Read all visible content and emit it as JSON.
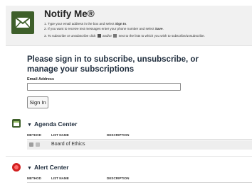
{
  "header": {
    "title": "Notify Me®",
    "line1": {
      "a": "1. Type your email address in the box and select ",
      "b": "Sign In",
      "c": "."
    },
    "line2": {
      "a": "2. If you want to receive text messages enter your phone number and select ",
      "b": "Save",
      "c": "."
    },
    "line3": {
      "a": "3. To subscribe or unsubscribe click ",
      "mid": " and/or ",
      "c": " next to the lists to which you wish to subscribe/unsubscribe."
    }
  },
  "signin": {
    "heading": "Please sign in to subscribe, unsubscribe, or manage your subscriptions",
    "email_label": "Email Address",
    "email_value": "",
    "button_label": "Sign In"
  },
  "sections": [
    {
      "title": "Agenda Center",
      "columns": [
        "METHOD",
        "LIST NAME",
        "DESCRIPTION"
      ],
      "rows": [
        {
          "name": "Board of Ethics"
        }
      ]
    },
    {
      "title": "Alert Center",
      "columns": [
        "METHOD",
        "LIST NAME",
        "DESCRIPTION"
      ],
      "rows": []
    }
  ],
  "colors": {
    "accent_green": "#3e5f2a",
    "alert_red": "#d12020",
    "heading": "#1f2d3d"
  }
}
